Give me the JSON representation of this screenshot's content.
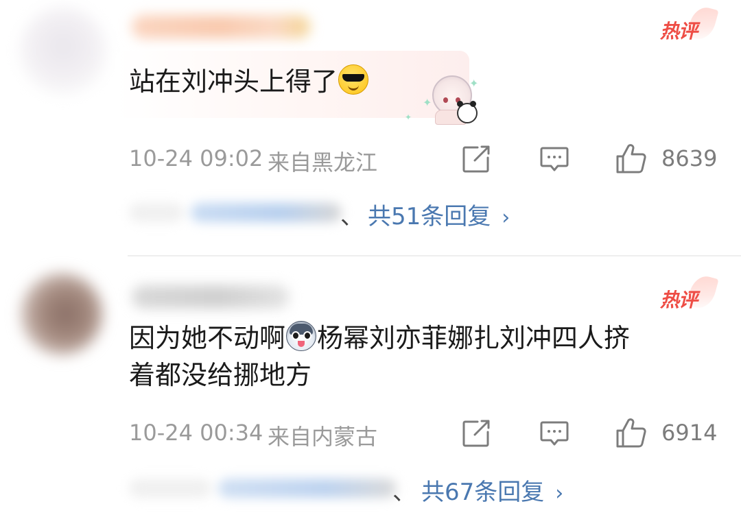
{
  "comments": [
    {
      "hot_badge": "热评",
      "text_lines": [
        "站在刘冲头上得了"
      ],
      "text_emoji": "sunglasses-emoji",
      "timestamp": "10-24 09:02",
      "location": "来自黑龙江",
      "like_count": "8639",
      "reply_person_suffix": "、",
      "replies_link": "共51条回复"
    },
    {
      "hot_badge": "热评",
      "text_segment_before_emoji": "因为她不动啊",
      "text_emoji": "husky-emoji",
      "text_segment_after_emoji": "杨幂刘亦菲娜扎刘冲四人挤",
      "text_line_2": "着都没给挪地方",
      "timestamp": "10-24 00:34",
      "location": "来自内蒙古",
      "like_count": "6914",
      "reply_person_suffix": "、",
      "replies_link": "共67条回复"
    }
  ],
  "icons": {
    "share": "share-icon",
    "reply": "comment-icon",
    "like": "thumbs-up-icon",
    "chevron": "chevron-right-icon"
  },
  "colors": {
    "hot_badge": "#ee4d45",
    "link": "#4a78b0",
    "meta": "#9a9a9a",
    "body_text": "#1a1a1a"
  }
}
